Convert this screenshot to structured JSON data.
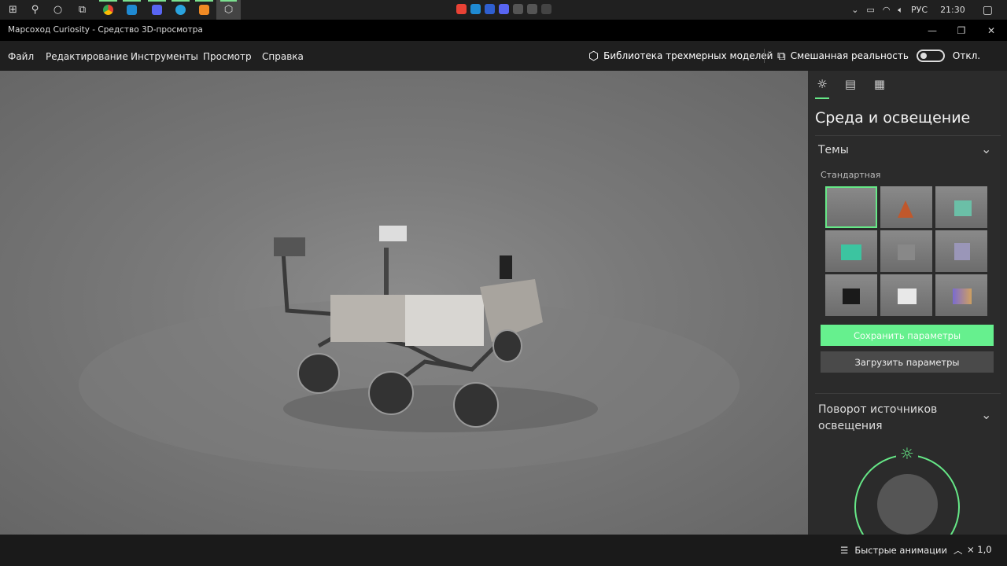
{
  "taskbar": {
    "tray": {
      "language": "РУС",
      "time": "21:30"
    }
  },
  "window": {
    "title": "Марсоход Curiosity - Средство 3D-просмотра",
    "minimize": "—",
    "maximize": "❐",
    "close": "✕"
  },
  "menu": {
    "items": [
      "Файл",
      "Редактирование",
      "Инструменты",
      "Просмотр",
      "Справка"
    ],
    "library": "Библиотека трехмерных моделей",
    "mixed_reality": "Смешанная реальность",
    "toggle_state": "Откл.",
    "toggle_on": false
  },
  "panel": {
    "title": "Среда и освещение",
    "themes": {
      "heading": "Темы",
      "subheading": "Стандартная",
      "selected_index": 0
    },
    "save_button": "Сохранить параметры",
    "load_button": "Загрузить параметры",
    "light_rotation": {
      "heading": "Поворот источников освещения"
    }
  },
  "bottom": {
    "animations": "Быстрые анимации",
    "speed": "× 1,0"
  },
  "colors": {
    "accent": "#66e887"
  }
}
